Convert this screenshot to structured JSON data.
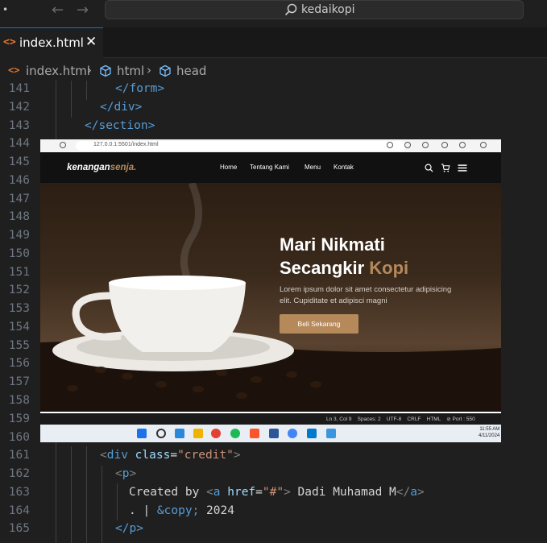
{
  "titlebar": {
    "search_text": "kedaikopi",
    "back_icon": "arrow-left-icon",
    "forward_icon": "arrow-right-icon"
  },
  "tab": {
    "label": "index.html",
    "close": "✕"
  },
  "breadcrumb": {
    "file": "index.html",
    "item1": "html",
    "item2": "head"
  },
  "editor": {
    "lines": [
      {
        "n": "141",
        "code": "</form>"
      },
      {
        "n": "142",
        "code": "</div>"
      },
      {
        "n": "143",
        "code": "</section>"
      },
      {
        "n": "144",
        "code": ""
      },
      {
        "n": "145",
        "code": ""
      },
      {
        "n": "146",
        "code": ""
      },
      {
        "n": "147",
        "code": ""
      },
      {
        "n": "148",
        "code": ""
      },
      {
        "n": "149",
        "code": ""
      },
      {
        "n": "150",
        "code": ""
      },
      {
        "n": "151",
        "code": ""
      },
      {
        "n": "152",
        "code": ""
      },
      {
        "n": "153",
        "code": ""
      },
      {
        "n": "154",
        "code": ""
      },
      {
        "n": "155",
        "code": ""
      },
      {
        "n": "156",
        "code": ""
      },
      {
        "n": "157",
        "code": ""
      },
      {
        "n": "158",
        "code": ""
      },
      {
        "n": "159",
        "code": ""
      },
      {
        "n": "160",
        "code": ""
      },
      {
        "n": "161",
        "code": "<div class=\"credit\">"
      },
      {
        "n": "162",
        "code": "<p>"
      },
      {
        "n": "163",
        "code": "Created by <a href=\"#\"> Dadi Muhamad M</a>"
      },
      {
        "n": "164",
        "code": ". | &copy; 2024"
      },
      {
        "n": "165",
        "code": "</p>"
      }
    ],
    "tokens": {
      "l141": "</form>",
      "l142": "</div>",
      "l143": "</section>",
      "l161_tag": "div",
      "l161_attr": "class",
      "l161_val": "\"credit\"",
      "l162_tag": "p",
      "l163_text": "Created by ",
      "l163_tag": "a",
      "l163_attr": "href",
      "l163_val": "\"#\"",
      "l163_link": " Dadi Muhamad M",
      "l163_close": "a",
      "l164_text": ". | ",
      "l164_entity": "&copy;",
      "l164_year": " 2024",
      "l165": "</p>"
    }
  },
  "screenshot": {
    "url": "127.0.0.1:5501/index.html",
    "brand": "kenangan",
    "brand_accent": "senja.",
    "nav": [
      "Home",
      "Tentang Kami",
      "Menu",
      "Kontak"
    ],
    "hero_title_1": "Mari Nikmati",
    "hero_title_2": "Secangkir ",
    "hero_title_accent": "Kopi",
    "hero_desc": "Lorem ipsum dolor sit amet consectetur adipisicing elit. Cupiditate et adipisci magni",
    "hero_button": "Beli Sekarang",
    "status_text": "Ln 3, Col 9    Spaces: 2    UTF-8    CRLF    HTML    ⊘ Port : 550",
    "time": "11:55 AM",
    "date": "4/11/2024"
  },
  "colors": {
    "accent": "#b6895b",
    "editor_bg": "#1f1f1f",
    "tag": "#569cd6",
    "attr": "#9cdcfe",
    "string": "#ce9178"
  }
}
